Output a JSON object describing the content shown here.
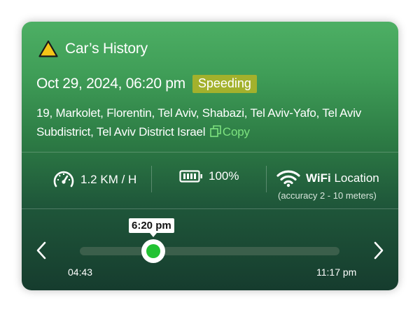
{
  "header": {
    "title": "Car’s History",
    "icon": "warning-icon",
    "icon_color": "#f5c518"
  },
  "event": {
    "datetime": "Oct 29, 2024, 06:20 pm",
    "badge": "Speeding",
    "badge_color": "#a3b12c"
  },
  "address": {
    "text": "19, Markolet, Florentin, Tel Aviv, Shabazi, Tel Aviv-Yafo, Tel Aviv Subdistrict, Tel Aviv District Israel",
    "copy_label": "Copy",
    "copy_color": "#7de27f"
  },
  "stats": {
    "speed": {
      "icon": "speedometer-icon",
      "value": "1.2 KM / H"
    },
    "battery": {
      "icon": "battery-icon",
      "value": "100%"
    },
    "wifi": {
      "icon": "wifi-icon",
      "label_bold": "WiFi",
      "label": "Location",
      "accuracy": "(accuracy 2 - 10 meters)"
    }
  },
  "timeline": {
    "current_label": "6:20 pm",
    "start_label": "04:43",
    "end_label": "11:17 pm",
    "position": 0.26,
    "knob_color": "#22c233",
    "prev_icon": "chevron-left-icon",
    "next_icon": "chevron-right-icon"
  }
}
